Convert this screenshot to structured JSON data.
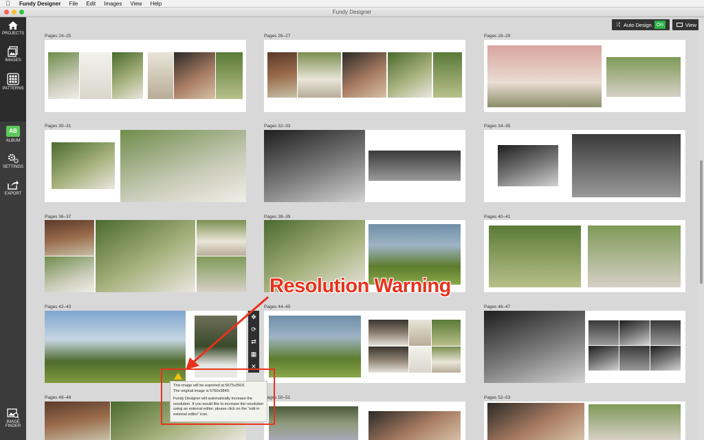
{
  "menubar": {
    "app": "Fundy Designer",
    "items": [
      "File",
      "Edit",
      "Images",
      "View",
      "Help"
    ]
  },
  "window": {
    "title": "Fundy Designer"
  },
  "sidebar": {
    "projects": "PROJECTS",
    "images": "IMAGES",
    "patterns": "PATTERNS",
    "album": "ALBUM",
    "album_badge": "AB",
    "settings": "SETTINGS",
    "export": "EXPORT",
    "image_finder_1": "IMAGE",
    "image_finder_2": "FINDER"
  },
  "controls": {
    "auto_design": "Auto Design",
    "auto_state": "On",
    "view": "View"
  },
  "spreads": [
    "Pages 24–25",
    "Pages 26–27",
    "Pages 28–29",
    "Pages 30–31",
    "Pages 32–33",
    "Pages 34–35",
    "Pages 36–37",
    "Pages 38–39",
    "Pages 40–41",
    "Pages 42–43",
    "Pages 44–45",
    "Pages 46–47",
    "Pages 48–49",
    "Pages 50–51",
    "Pages 52–53"
  ],
  "warning": {
    "line1": "This image will be exported at 5675x3916.",
    "line2": "The original image is 5760x3840.",
    "body": "Fundy Designer will automatically increase the resolution. If you would like to increase the resolution using an external editor, please click on the \"edit in external editor\" icon."
  },
  "callout": "Resolution Warning",
  "colors": {
    "accent": "#e8321e",
    "on": "#2bb34a",
    "warn": "#f4c20d"
  }
}
